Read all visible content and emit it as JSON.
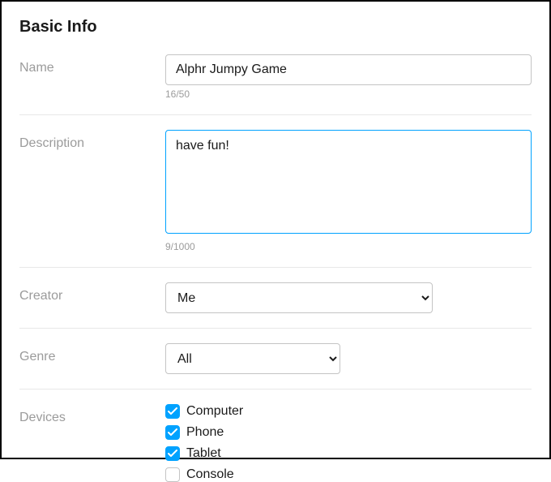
{
  "section": {
    "title": "Basic Info"
  },
  "fields": {
    "name": {
      "label": "Name",
      "value": "Alphr Jumpy Game",
      "counter": "16/50"
    },
    "description": {
      "label": "Description",
      "value": "have fun!",
      "counter": "9/1000"
    },
    "creator": {
      "label": "Creator",
      "value": "Me"
    },
    "genre": {
      "label": "Genre",
      "value": "All"
    },
    "devices": {
      "label": "Devices",
      "items": [
        {
          "label": "Computer",
          "checked": true
        },
        {
          "label": "Phone",
          "checked": true
        },
        {
          "label": "Tablet",
          "checked": true
        },
        {
          "label": "Console",
          "checked": false
        }
      ]
    }
  }
}
